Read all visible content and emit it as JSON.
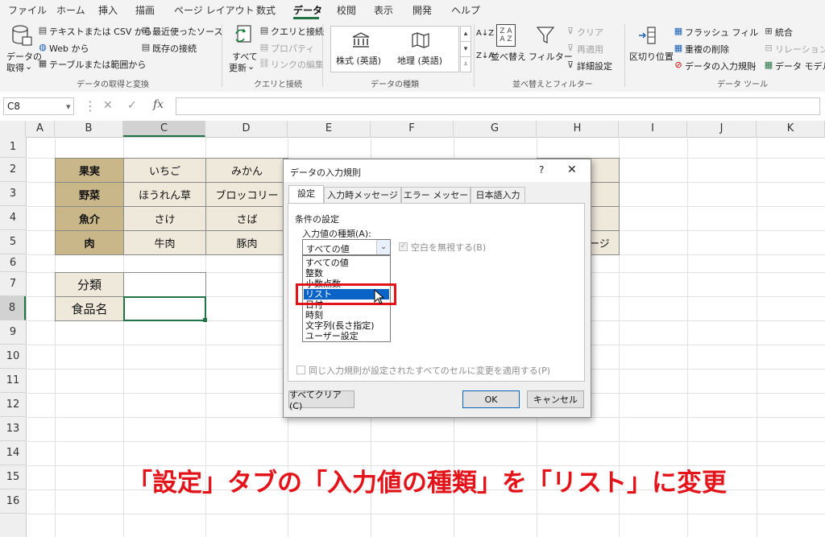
{
  "menu": {
    "items": [
      "ファイル",
      "ホーム",
      "挿入",
      "描画",
      "ページ レイアウト",
      "数式",
      "データ",
      "校閲",
      "表示",
      "開発",
      "ヘルプ"
    ],
    "active": "データ"
  },
  "ribbon": {
    "get_data_label_1": "データの",
    "get_data_label_2": "取得",
    "text_csv": "テキストまたは CSV から",
    "web": "Web から",
    "table_range": "テーブルまたは範囲から",
    "recent_sources": "最近使ったソース",
    "existing_connections": "既存の接続",
    "group_get_transform": "データの取得と変換",
    "refresh_all_1": "すべて",
    "refresh_all_2": "更新",
    "queries_connections": "クエリと接続",
    "properties": "プロパティ",
    "edit_links": "リンクの編集",
    "group_queries": "クエリと接続",
    "stocks": "株式 (英語)",
    "geography": "地理 (英語)",
    "group_data_types": "データの種類",
    "sort": "並べ替え",
    "filter": "フィルター",
    "clear": "クリア",
    "reapply": "再適用",
    "advanced": "詳細設定",
    "group_sort_filter": "並べ替えとフィルター",
    "text_to_columns": "区切り位置",
    "flash_fill": "フラッシュ フィル",
    "remove_duplicates": "重複の削除",
    "data_validation": "データの入力規則",
    "consolidate": "統合",
    "relationships": "リレーションシ",
    "data_model": "データ モデルの",
    "group_data_tools": "データ ツール"
  },
  "formula_bar": {
    "name_box": "C8",
    "cancel": "✕",
    "enter": "✓",
    "fx": "fx",
    "value": ""
  },
  "columns": [
    "A",
    "B",
    "C",
    "D",
    "E",
    "F",
    "G",
    "H",
    "I",
    "J",
    "K"
  ],
  "rows": [
    "1",
    "2",
    "3",
    "4",
    "5",
    "6",
    "7",
    "8",
    "9",
    "10",
    "11",
    "12",
    "13",
    "14",
    "15",
    "16"
  ],
  "table": {
    "rows": [
      {
        "category": "果実",
        "c": "いちご",
        "d": "みかん"
      },
      {
        "category": "野菜",
        "c": "ほうれん草",
        "d": "ブロッコリー"
      },
      {
        "category": "魚介",
        "c": "さけ",
        "d": "さば"
      },
      {
        "category": "肉",
        "c": "牛肉",
        "d": "豚肉",
        "h": "ージ"
      }
    ]
  },
  "inputs": {
    "label_category": "分類",
    "label_food": "食品名",
    "value_category": "",
    "value_food": ""
  },
  "dialog": {
    "title": "データの入力規則",
    "help": "?",
    "close": "✕",
    "tabs": [
      "設定",
      "入力時メッセージ",
      "エラー メッセージ",
      "日本語入力"
    ],
    "section": "条件の設定",
    "allow_label": "入力値の種類(A):",
    "allow_value": "すべての値",
    "ignore_blank": "空白を無視する(B)",
    "options": [
      "すべての値",
      "整数",
      "小数点数",
      "リスト",
      "日付",
      "時刻",
      "文字列(長さ指定)",
      "ユーザー設定"
    ],
    "selected_option": "リスト",
    "apply_all": "同じ入力規則が設定されたすべてのセルに変更を適用する(P)",
    "clear_all": "すべてクリア(C)",
    "ok": "OK",
    "cancel": "キャンセル"
  },
  "caption": "「設定」タブの「入力値の種類」を「リスト」に変更",
  "colors": {
    "accent": "#217346",
    "category_fill": "#c9b78a",
    "value_fill": "#efe9dc",
    "highlight_red": "#e3131a",
    "list_selection": "#0a64c8"
  }
}
